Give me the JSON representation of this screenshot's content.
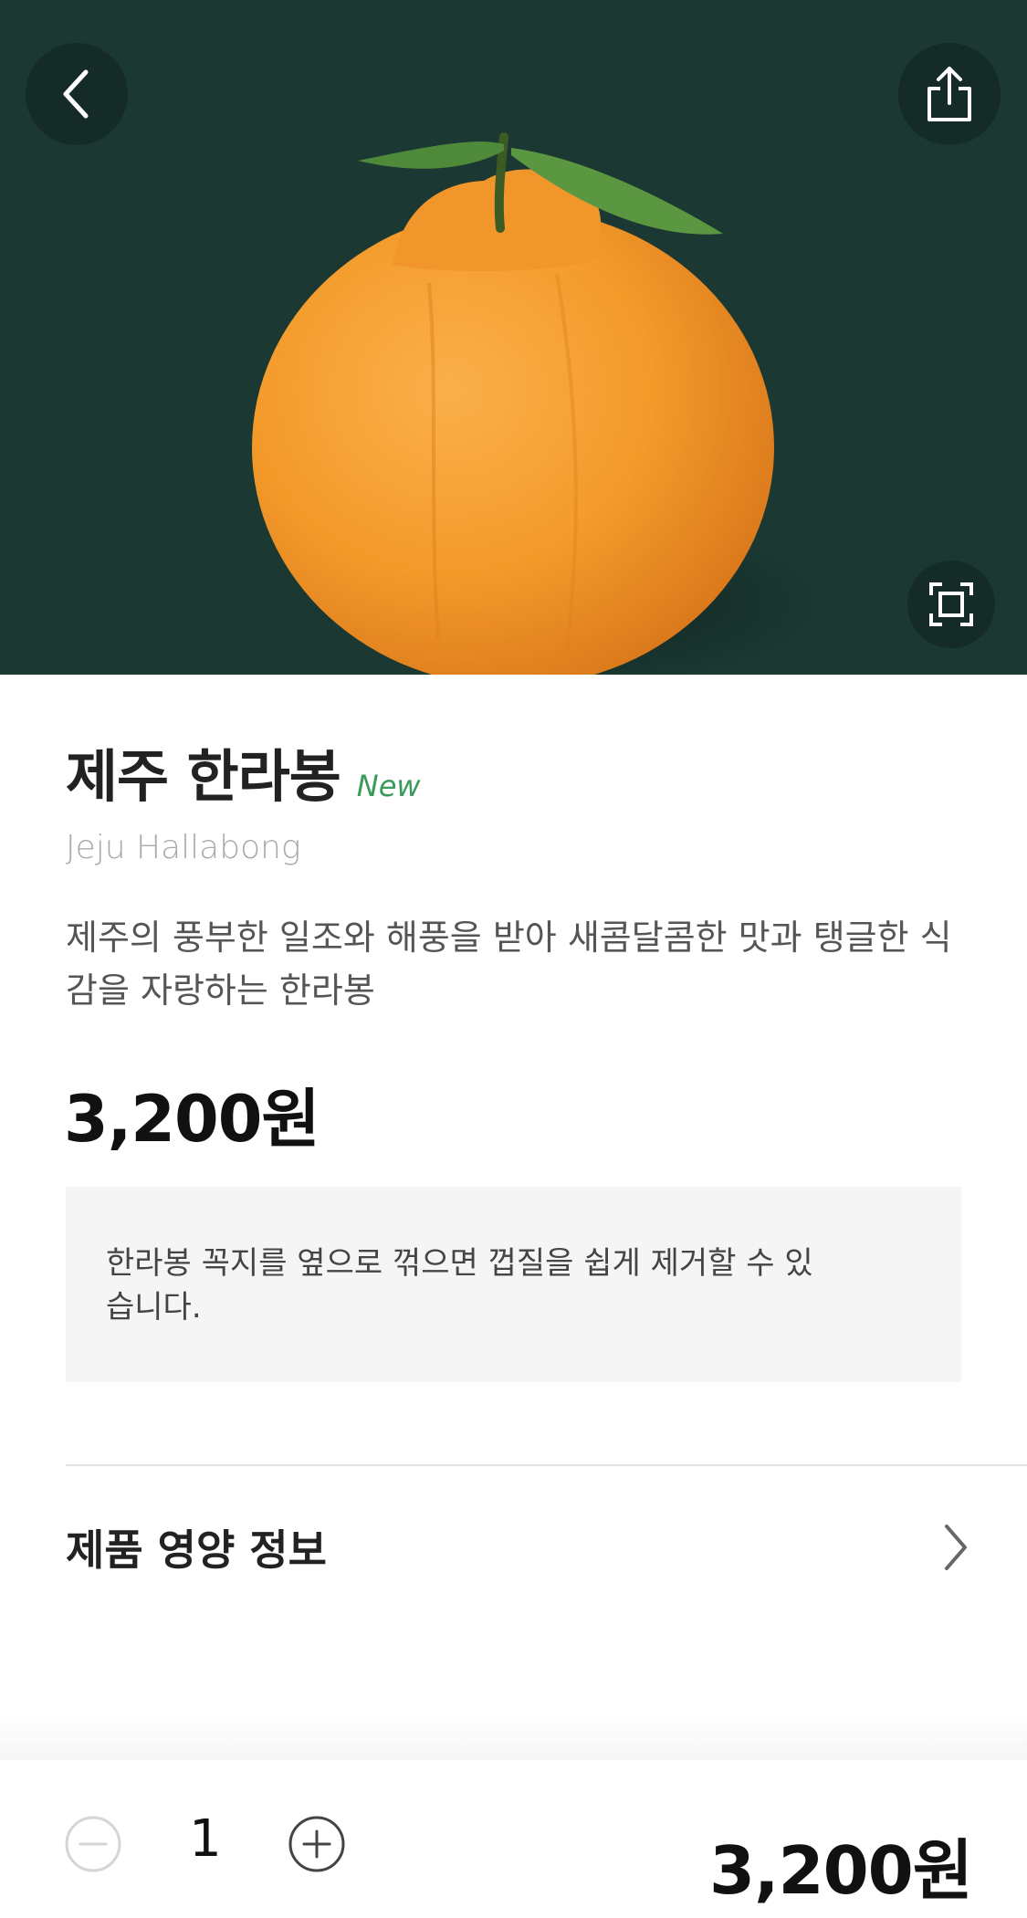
{
  "product": {
    "name": "제주 한라봉",
    "badge": "New",
    "name_en": "Jeju Hallabong",
    "description": "제주의 풍부한 일조와 해풍을 받아 새콤달콤한 맛과 탱글한 식감을 자랑하는 한라봉",
    "price": "3,200원",
    "notice": "한라봉 꼭지를 옆으로 꺾으면 껍질을 쉽게 제거할 수 있습니다."
  },
  "nutrition": {
    "label": "제품 영양 정보"
  },
  "order": {
    "quantity": "1",
    "total": "3,200원"
  },
  "icons": {
    "back": "chevron-left-icon",
    "share": "share-icon",
    "zoom": "fullscreen-icon",
    "nutrition_arrow": "chevron-right-icon",
    "minus": "minus-circle-icon",
    "plus": "plus-circle-icon"
  },
  "colors": {
    "hero_background": "#1b3832",
    "badge_new": "#3a9a5a",
    "notice_background": "#f5f5f5"
  }
}
